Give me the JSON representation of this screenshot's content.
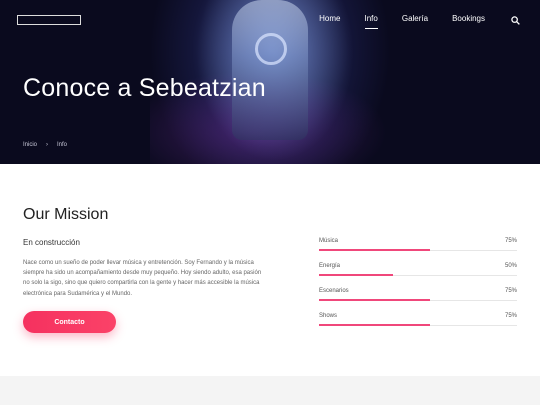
{
  "nav": {
    "items": [
      {
        "label": "Home",
        "active": false
      },
      {
        "label": "Info",
        "active": true
      },
      {
        "label": "Galería",
        "active": false
      },
      {
        "label": "Bookings",
        "active": false
      }
    ],
    "search_icon": "search-icon"
  },
  "hero": {
    "title": "Conoce a Sebeatzian",
    "breadcrumb": [
      "Inicio",
      "Info"
    ]
  },
  "mission": {
    "title": "Our Mission",
    "subtitle": "En construcción",
    "description": "Nace como un sueño de poder llevar música y entretención. Soy Fernando y la música siempre ha sido un acompañamiento desde muy pequeño. Hoy siendo adulto, esa pasión no solo la sigo, sino que quiero compartirla con la gente y hacer más accesible la música electrónica para Sudamérica y el Mundo.",
    "button_label": "Contacto"
  },
  "skills": [
    {
      "label": "Música",
      "percent_text": "75%",
      "value": 0.75
    },
    {
      "label": "Energía",
      "percent_text": "50%",
      "value": 0.5
    },
    {
      "label": "Escenarios",
      "percent_text": "75%",
      "value": 0.75
    },
    {
      "label": "Shows",
      "percent_text": "75%",
      "value": 0.75
    }
  ],
  "colors": {
    "accent": "#f5315f",
    "bar": "#f0477b"
  }
}
